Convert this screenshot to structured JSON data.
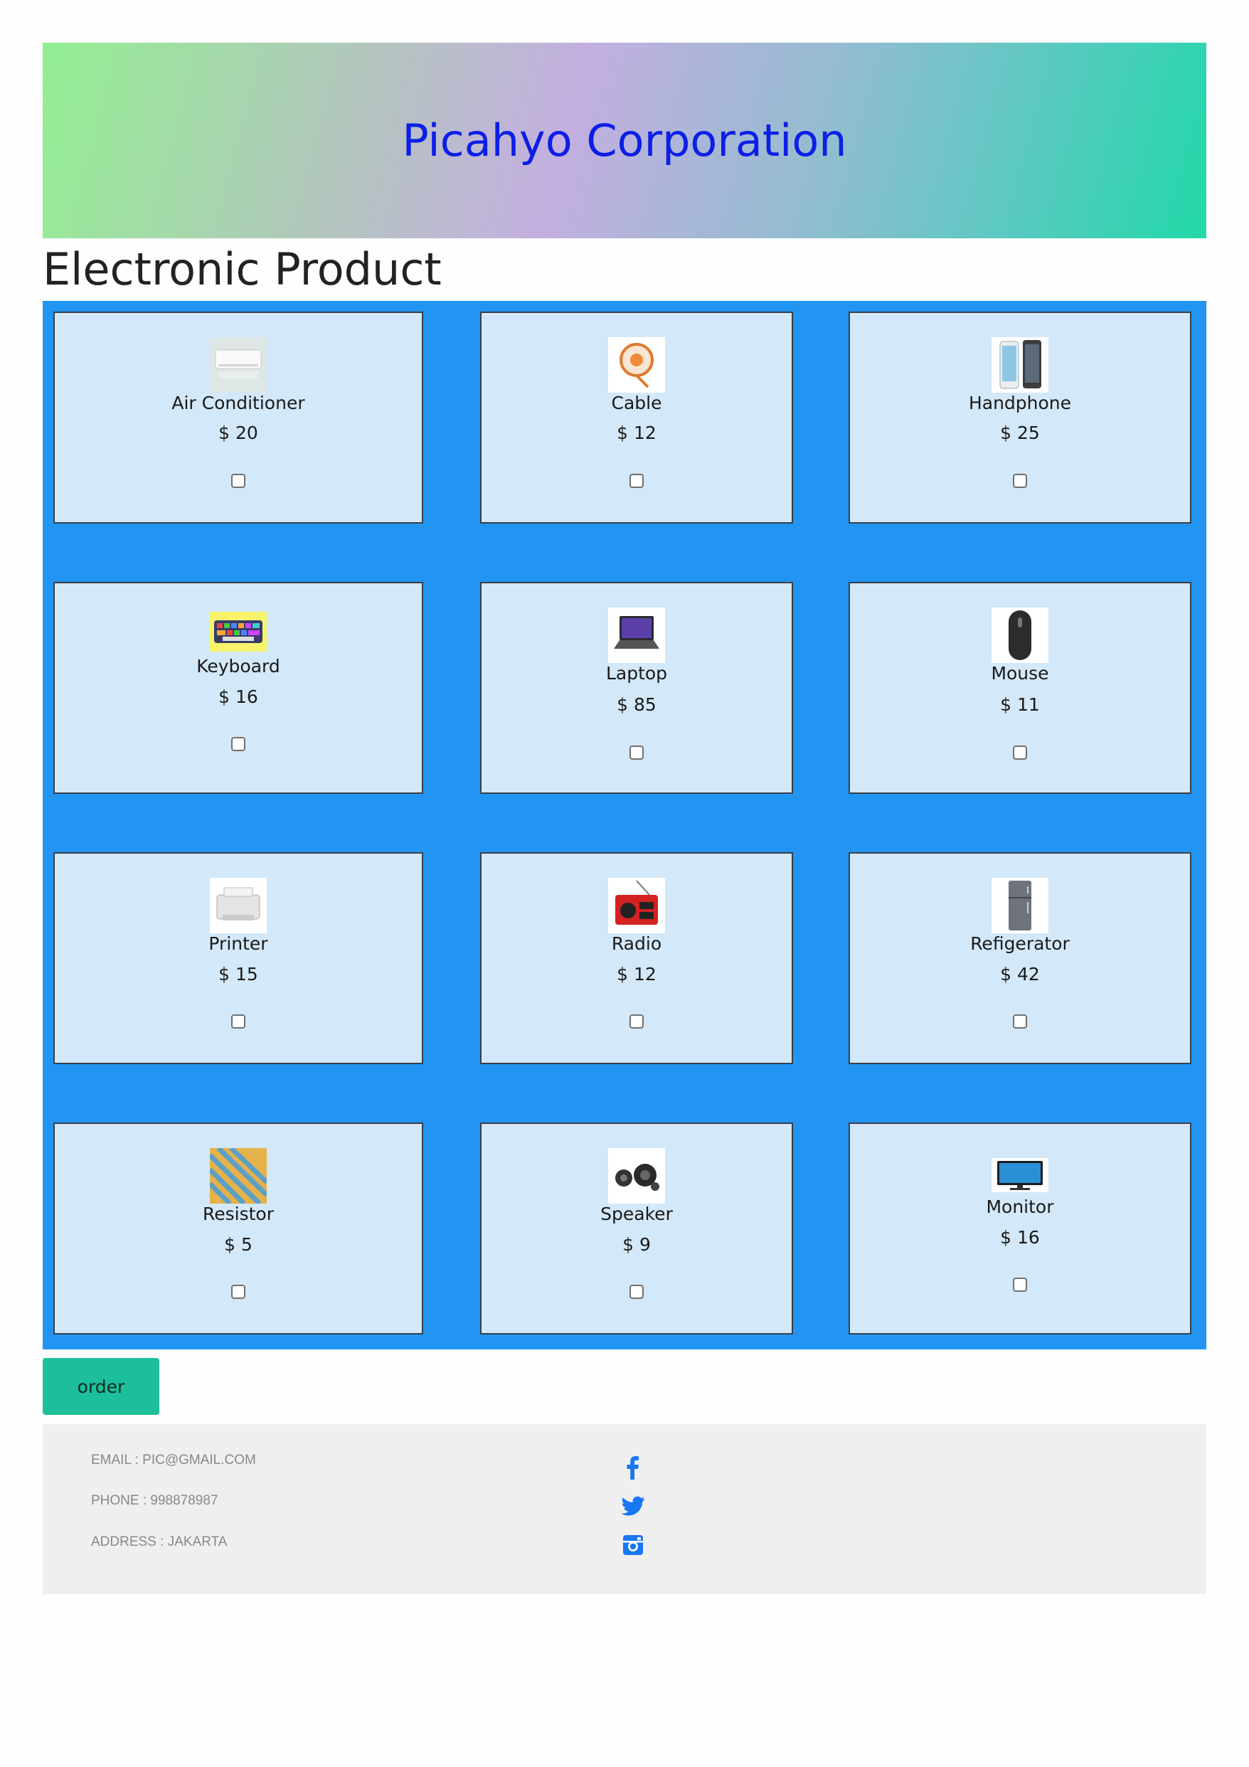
{
  "header": {
    "title": "Picahyo Corporation",
    "gradient_start": "#93ef92",
    "gradient_mid": "#c3afe0",
    "gradient_end": "#21d8a8"
  },
  "section_title": "Electronic Product",
  "products": [
    {
      "name": "Air Conditioner",
      "price": "$ 20",
      "icon": "air-conditioner",
      "checked": false
    },
    {
      "name": "Cable",
      "price": "$ 12",
      "icon": "cable-reel",
      "checked": false
    },
    {
      "name": "Handphone",
      "price": "$ 25",
      "icon": "smartphones",
      "checked": false
    },
    {
      "name": "Keyboard",
      "price": "$ 16",
      "icon": "keyboard",
      "checked": false
    },
    {
      "name": "Laptop",
      "price": "$ 85",
      "icon": "laptop",
      "checked": false
    },
    {
      "name": "Mouse",
      "price": "$ 11",
      "icon": "mouse",
      "checked": false
    },
    {
      "name": "Printer",
      "price": "$ 15",
      "icon": "printer",
      "checked": false
    },
    {
      "name": "Radio",
      "price": "$ 12",
      "icon": "radio",
      "checked": false
    },
    {
      "name": "Refigerator",
      "price": "$ 42",
      "icon": "refrigerator",
      "checked": false
    },
    {
      "name": "Resistor",
      "price": "$ 5",
      "icon": "resistors",
      "checked": false
    },
    {
      "name": "Speaker",
      "price": "$ 9",
      "icon": "speakers",
      "checked": false
    },
    {
      "name": "Monitor",
      "price": "$ 16",
      "icon": "monitor",
      "checked": false
    }
  ],
  "order_button": "order",
  "footer": {
    "email": "EMAIL : PIC@GMAIL.COM",
    "phone": "PHONE : 998878987",
    "address": "ADDRESS : JAKARTA",
    "social_icons": [
      "facebook-icon",
      "twitter-icon",
      "instagram-icon"
    ]
  },
  "colors": {
    "grid_bg": "#2295f2",
    "card_bg": "#d3e8f8",
    "button_bg": "#1dbf9b",
    "footer_bg": "#efefef",
    "title_color": "#0c1fe6",
    "social_color": "#1877f2"
  }
}
